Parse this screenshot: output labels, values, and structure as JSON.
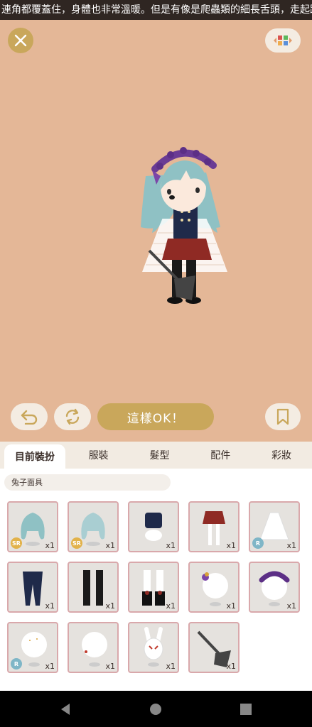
{
  "ticker": {
    "text": "連角都覆蓋住，身體也非常溫暖。但是有像是爬蟲類的細長舌頭，走起路"
  },
  "stage": {
    "ok_label": "這樣OK！"
  },
  "tabs": [
    {
      "label": "目前裝扮"
    },
    {
      "label": "服裝"
    },
    {
      "label": "髮型"
    },
    {
      "label": "配件"
    },
    {
      "label": "彩妝"
    }
  ],
  "panel": {
    "selected_name": "兔子面具"
  },
  "items": [
    {
      "icon": "wig-long-teal-icon",
      "rarity": "SR",
      "qty": "x1"
    },
    {
      "icon": "wig-long-mint-icon",
      "rarity": "SR",
      "qty": "x1"
    },
    {
      "icon": "navy-vest-top-icon",
      "rarity": "",
      "qty": "x1"
    },
    {
      "icon": "red-skirt-icon",
      "rarity": "",
      "qty": "x1"
    },
    {
      "icon": "lace-cape-icon",
      "rarity": "R",
      "qty": "x1"
    },
    {
      "icon": "star-tights-icon",
      "rarity": "",
      "qty": "x1"
    },
    {
      "icon": "black-stockings-icon",
      "rarity": "",
      "qty": "x1"
    },
    {
      "icon": "ribbon-boots-icon",
      "rarity": "",
      "qty": "x1"
    },
    {
      "icon": "flower-hairpin-icon",
      "rarity": "",
      "qty": "x1"
    },
    {
      "icon": "purple-flower-crown-icon",
      "rarity": "",
      "qty": "x1"
    },
    {
      "icon": "starry-face-makeup-icon",
      "rarity": "R",
      "qty": "x1"
    },
    {
      "icon": "cheek-makeup-icon",
      "rarity": "",
      "qty": "x1"
    },
    {
      "icon": "rabbit-mask-icon",
      "rarity": "",
      "qty": "x1"
    },
    {
      "icon": "axe-icon",
      "rarity": "",
      "qty": "x1"
    }
  ],
  "colors": {
    "stage_bg": "#e4b797",
    "gold": "#c9a75b",
    "sr_badge": "#e2b24a",
    "r_badge": "#7fb6c7",
    "item_border": "#d9a8ab"
  }
}
